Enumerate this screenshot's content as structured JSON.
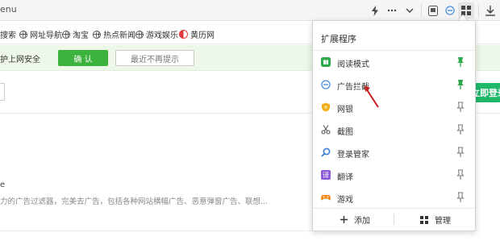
{
  "toolbar": {
    "address_text": "enu",
    "icons": [
      "lightning-icon",
      "more-icon",
      "chevron-down-icon",
      "reading-mode-icon",
      "adblock-icon",
      "extensions-icon",
      "download-icon"
    ]
  },
  "bookmarks": [
    {
      "label": "搜索",
      "icon": "globe-icon"
    },
    {
      "label": "网址导航",
      "icon": "globe-icon"
    },
    {
      "label": "淘宝",
      "icon": "globe-icon"
    },
    {
      "label": "热点新闻",
      "icon": "globe-icon"
    },
    {
      "label": "游戏娱乐",
      "icon": "globe-icon"
    },
    {
      "label": "黄历网",
      "icon": "yinyang-icon"
    }
  ],
  "notice": {
    "text": "护上网安全",
    "confirm_label": "确 认",
    "later_label": "最近不再提示"
  },
  "page": {
    "login_label": "立即登录",
    "fragment_small": "e",
    "description": "力的广告过滤器，完美去广告，包括各种网站横幅广告、恶意弹窗广告、联想..."
  },
  "popup": {
    "title": "扩展程序",
    "items": [
      {
        "label": "阅读模式",
        "icon": "reading-mode-icon",
        "pinned": true
      },
      {
        "label": "广告拦截",
        "icon": "adblock-icon",
        "pinned": true
      },
      {
        "label": "网银",
        "icon": "bank-shield-icon",
        "pinned": false
      },
      {
        "label": "截图",
        "icon": "scissors-icon",
        "pinned": false
      },
      {
        "label": "登录管家",
        "icon": "key-search-icon",
        "pinned": false
      },
      {
        "label": "翻译",
        "icon": "translate-icon",
        "pinned": false
      },
      {
        "label": "游戏",
        "icon": "gamepad-icon",
        "pinned": false
      }
    ],
    "footer": {
      "add_label": "添加",
      "manage_label": "管理"
    }
  },
  "colors": {
    "accent_green": "#3db33d",
    "pin_green": "#2eaa4a",
    "login_green": "#1fb76a",
    "annotation_red": "#cc1f1f"
  }
}
